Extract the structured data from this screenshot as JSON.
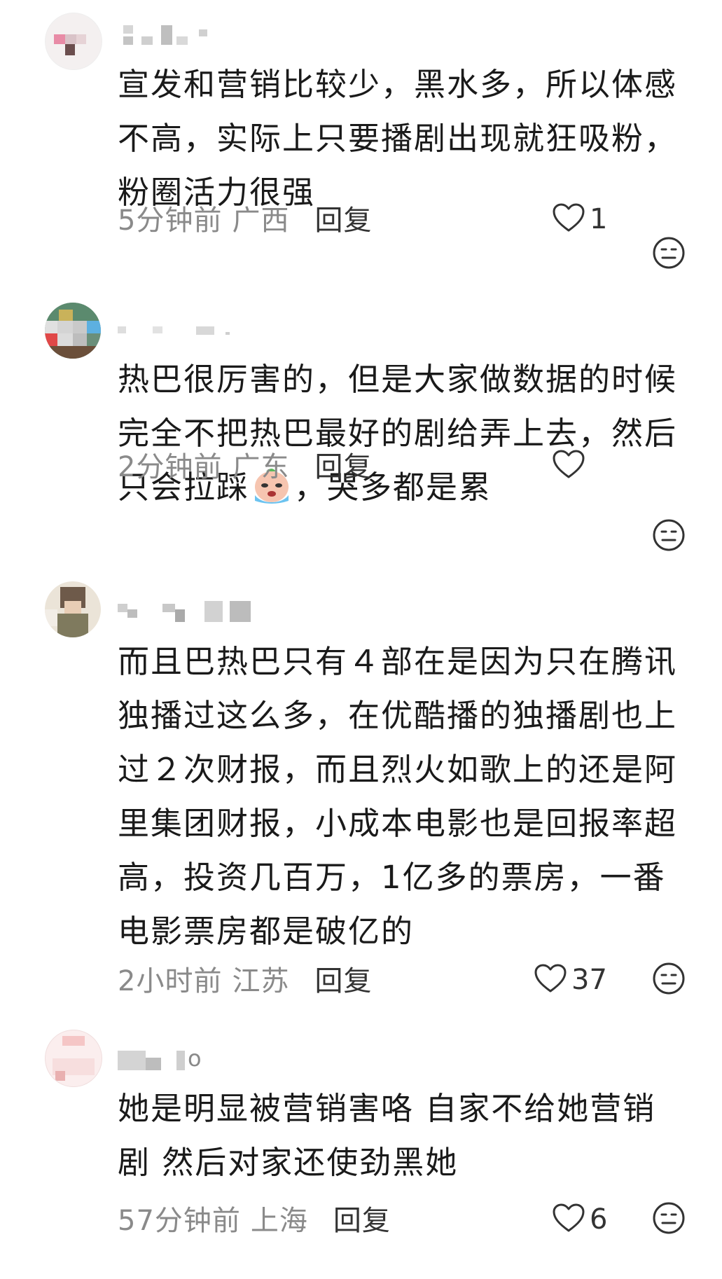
{
  "comments": [
    {
      "text": "宣发和营销比较少，黑水多，所以体感不高，实际上只要播剧出现就狂吸粉，粉圈活力很强",
      "time": "5分钟前",
      "region": "广西",
      "reply": "回复",
      "likes": "1"
    },
    {
      "text_before": "热巴很厉害的，但是大家做数据的时候完全不把热巴最好的剧给弄上去，然后只会拉踩",
      "text_after": "，哭多都是累",
      "emoji": "crying-face-emoji",
      "time": "2分钟前",
      "region": "广东",
      "reply": "回复",
      "likes": ""
    },
    {
      "text": "而且巴热巴只有４部在是因为只在腾讯独播过这么多，在优酷播的独播剧也上过２次财报，而且烈火如歌上的还是阿里集团财报，小成本电影也是回报率超高，投资几百万，1亿多的票房，一番电影票房都是破亿的",
      "time": "2小时前",
      "region": "江苏",
      "reply": "回复",
      "likes": "37"
    },
    {
      "text": "她是明显被营销害咯 自家不给她营销剧 然后对家还使劲黑她",
      "time": "57分钟前",
      "region": "上海",
      "reply": "回复",
      "likes": "6"
    }
  ],
  "usernames": [
    "",
    "",
    "",
    "o"
  ],
  "icons": {
    "like": "heart-outline-icon",
    "dislike": "neutral-face-icon"
  },
  "colors": {
    "text": "#1a1a1a",
    "meta": "#8a8a8a",
    "icon": "#333333"
  }
}
